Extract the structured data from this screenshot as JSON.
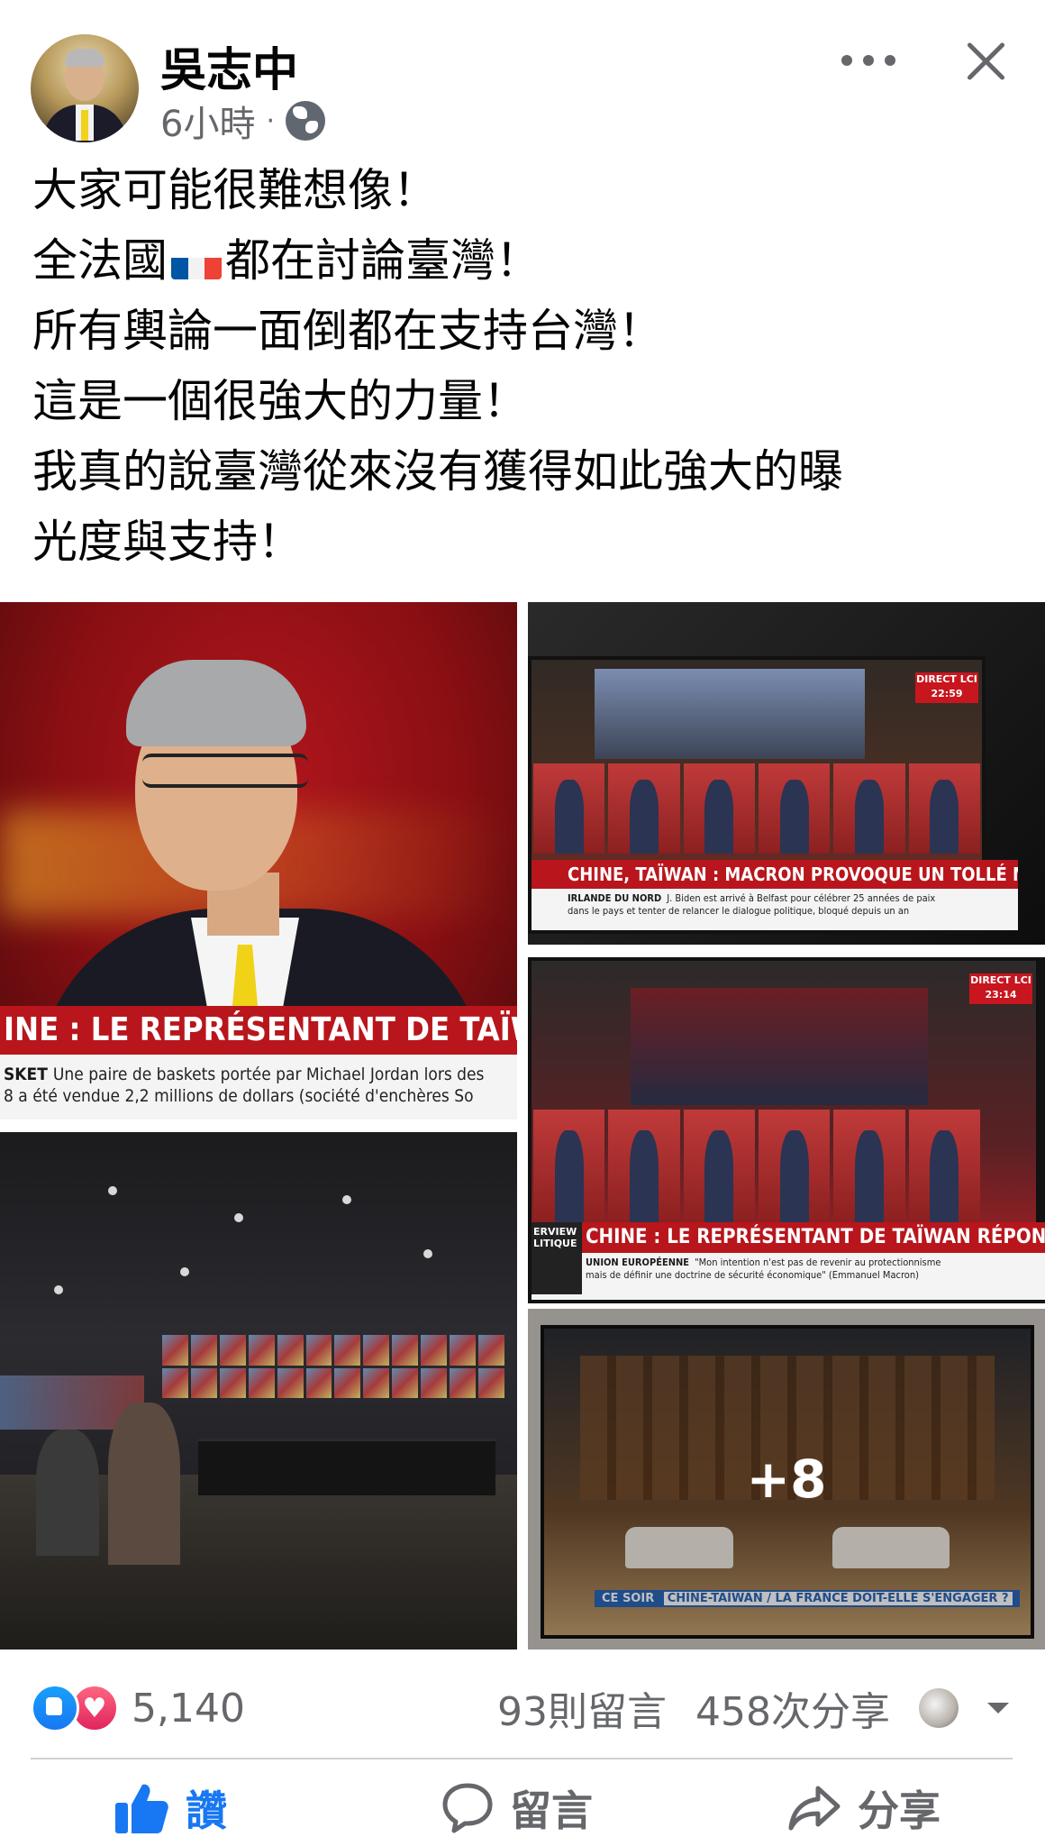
{
  "post": {
    "author": "吳志中",
    "timestamp": "6小時",
    "separator": "·",
    "privacy_icon": "globe-icon",
    "more_icon": "more-horizontal-icon",
    "close_icon": "close-icon",
    "text_lines": {
      "l1": "大家可能很難想像！",
      "l2a": "全法國",
      "l2_emoji": "french-flag-emoji",
      "l2b": "都在討論臺灣！",
      "l3": "所有輿論一面倒都在支持台灣！",
      "l4": "這是一個很強大的力量！",
      "l5": "我真的說臺灣從來沒有獲得如此強大的曝",
      "l6": "光度與支持！"
    },
    "flag_colors": [
      "#0055A4",
      "#FFFFFF",
      "#EF4135"
    ]
  },
  "images": {
    "img1": {
      "banner": "INE : LE REPRÉSENTANT DE TAÏWAN RÉPON",
      "ticker_tag": "SKET",
      "ticker_line1": "Une paire de baskets portée par Michael Jordan lors des",
      "ticker_line2": "8 a été vendue 2,2 millions de dollars (société d'enchères So"
    },
    "img2": {
      "channel": "DIRECT LCI",
      "time": "22:59",
      "banner": "CHINE, TAÏWAN : MACRON PROVOQUE UN TOLLÉ MONDIAL",
      "ticker_tag": "IRLANDE DU NORD",
      "ticker_line1": "J. Biden est arrivé à Belfast pour célébrer 25 années de paix",
      "ticker_line2": "dans le pays et tenter de relancer le dialogue politique, bloqué depuis un an"
    },
    "img4": {
      "channel": "DIRECT LCI",
      "time": "23:14",
      "side_label": "ERVIEW LITIQUE",
      "banner": "CHINE : LE REPRÉSENTANT DE TAÏWAN RÉPOND À LCI",
      "ticker_tag": "UNION EUROPÉENNE",
      "ticker_line1": "\"Mon intention n'est pas de revenir au protectionnisme",
      "ticker_line2": "mais de définir une doctrine de sécurité économique\" (Emmanuel Macron)"
    },
    "img5": {
      "show_label": "CE SOIR",
      "show_topic": "CHINE-TAÏWAN / LA FRANCE DOIT-ELLE S'ENGAGER ?",
      "more_count": "+8"
    }
  },
  "stats": {
    "reaction_count": "5,140",
    "comments": "93則留言",
    "shares": "458次分享"
  },
  "actions": {
    "like": "讚",
    "comment": "留言",
    "share": "分享"
  },
  "colors": {
    "facebook_blue": "#1877f2",
    "secondary_text": "#65676b",
    "lci_red": "#b8161c"
  }
}
